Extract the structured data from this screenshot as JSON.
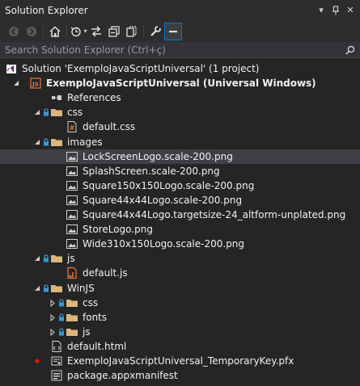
{
  "panel": {
    "title": "Solution Explorer",
    "title_controls": [
      {
        "name": "dropdown-icon",
        "glyph": "▾"
      },
      {
        "name": "pin-icon",
        "glyph": "📌"
      },
      {
        "name": "close-icon",
        "glyph": "✕"
      }
    ]
  },
  "toolbar": {
    "buttons": [
      {
        "name": "back-icon",
        "enabled": false
      },
      {
        "name": "forward-icon",
        "enabled": false
      },
      {
        "name": "home-icon",
        "enabled": true
      },
      {
        "name": "pending-changes-filter-icon",
        "enabled": true,
        "dropdown": true
      },
      {
        "name": "sync-with-document-icon",
        "enabled": true
      },
      {
        "name": "collapse-all-icon",
        "enabled": true
      },
      {
        "name": "show-all-files-icon",
        "enabled": true
      },
      {
        "name": "properties-wrench-icon",
        "enabled": true
      },
      {
        "name": "preview-selected-items-icon",
        "enabled": true,
        "active": true
      }
    ]
  },
  "search": {
    "placeholder": "Search Solution Explorer (Ctrl+ç)"
  },
  "tree": {
    "items": [
      {
        "label": "Solution 'ExemploJavaScriptUniversal' (1 project)",
        "icon": "solution-icon",
        "depth": 0,
        "expander": "none",
        "lock": false,
        "bold": false
      },
      {
        "label": "ExemploJavaScriptUniversal (Universal Windows)",
        "icon": "js-project-icon",
        "depth": 1,
        "expander": "expanded",
        "lock": false,
        "bold": true
      },
      {
        "label": "References",
        "icon": "references-icon",
        "depth": 2,
        "expander": "none",
        "lock": false,
        "bold": false
      },
      {
        "label": "css",
        "icon": "folder-icon",
        "depth": 2,
        "expander": "expanded",
        "lock": true,
        "bold": false
      },
      {
        "label": "default.css",
        "icon": "css-file-icon",
        "depth": 3,
        "expander": "none",
        "lock": false,
        "bold": false
      },
      {
        "label": "images",
        "icon": "folder-icon",
        "depth": 2,
        "expander": "expanded",
        "lock": true,
        "bold": false
      },
      {
        "label": "LockScreenLogo.scale-200.png",
        "icon": "image-file-icon",
        "depth": 3,
        "expander": "none",
        "lock": false,
        "bold": false,
        "selected": true
      },
      {
        "label": "SplashScreen.scale-200.png",
        "icon": "image-file-icon",
        "depth": 3,
        "expander": "none",
        "lock": false,
        "bold": false
      },
      {
        "label": "Square150x150Logo.scale-200.png",
        "icon": "image-file-icon",
        "depth": 3,
        "expander": "none",
        "lock": false,
        "bold": false
      },
      {
        "label": "Square44x44Logo.scale-200.png",
        "icon": "image-file-icon",
        "depth": 3,
        "expander": "none",
        "lock": false,
        "bold": false
      },
      {
        "label": "Square44x44Logo.targetsize-24_altform-unplated.png",
        "icon": "image-file-icon",
        "depth": 3,
        "expander": "none",
        "lock": false,
        "bold": false
      },
      {
        "label": "StoreLogo.png",
        "icon": "image-file-icon",
        "depth": 3,
        "expander": "none",
        "lock": false,
        "bold": false
      },
      {
        "label": "Wide310x150Logo.scale-200.png",
        "icon": "image-file-icon",
        "depth": 3,
        "expander": "none",
        "lock": false,
        "bold": false
      },
      {
        "label": "js",
        "icon": "folder-icon",
        "depth": 2,
        "expander": "expanded",
        "lock": true,
        "bold": false
      },
      {
        "label": "default.js",
        "icon": "js-file-icon",
        "depth": 3,
        "expander": "none",
        "lock": false,
        "bold": false
      },
      {
        "label": "WinJS",
        "icon": "folder-icon",
        "depth": 2,
        "expander": "expanded",
        "lock": true,
        "bold": false
      },
      {
        "label": "css",
        "icon": "folder-icon",
        "depth": 3,
        "expander": "collapsed",
        "lock": true,
        "bold": false
      },
      {
        "label": "fonts",
        "icon": "folder-icon",
        "depth": 3,
        "expander": "collapsed",
        "lock": true,
        "bold": false
      },
      {
        "label": "js",
        "icon": "folder-icon",
        "depth": 3,
        "expander": "collapsed",
        "lock": true,
        "bold": false
      },
      {
        "label": "default.html",
        "icon": "html-file-icon",
        "depth": 2,
        "expander": "none",
        "lock": false,
        "bold": false
      },
      {
        "label": "ExemploJavaScriptUniversal_TemporaryKey.pfx",
        "icon": "certificate-file-icon",
        "depth": 2,
        "expander": "none",
        "lock": false,
        "bold": false,
        "badge": "red-dot"
      },
      {
        "label": "package.appxmanifest",
        "icon": "manifest-file-icon",
        "depth": 2,
        "expander": "none",
        "lock": false,
        "bold": false
      }
    ]
  },
  "colors": {
    "background": "#252526",
    "chrome": "#2d2d30",
    "selection": "#3f3f46",
    "accent": "#007acc",
    "folder": "#dcb67a",
    "lock": "#3c99d4",
    "js_orange": "#e8773c"
  }
}
